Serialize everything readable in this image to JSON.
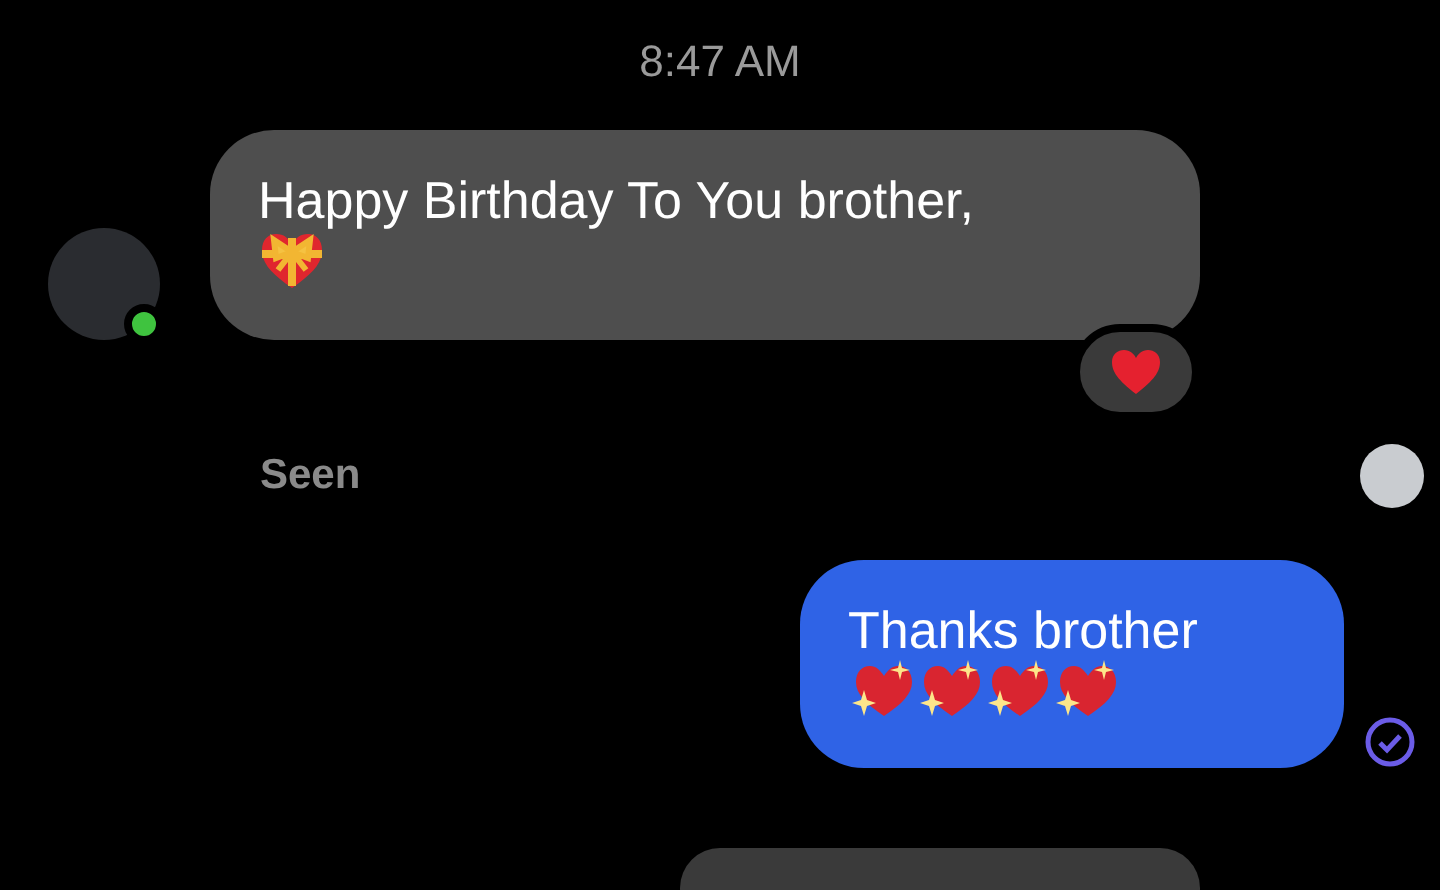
{
  "timestamp": "8:47 AM",
  "incoming": {
    "text": "Happy Birthday To You brother,",
    "emojis": [
      {
        "kind": "gift_heart"
      }
    ],
    "online": true,
    "reactions": [
      {
        "kind": "red_heart"
      }
    ]
  },
  "seen": {
    "label": "Seen"
  },
  "outgoing": {
    "text": "Thanks brother",
    "emojis": [
      {
        "kind": "sparkling_heart"
      },
      {
        "kind": "sparkling_heart"
      },
      {
        "kind": "sparkling_heart"
      },
      {
        "kind": "sparkling_heart"
      }
    ],
    "delivered": true
  }
}
